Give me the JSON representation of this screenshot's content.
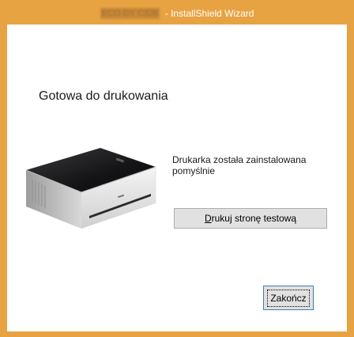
{
  "window": {
    "title_redacted": "ECO-DY CIDB",
    "title_suffix": "- InstallShield Wizard",
    "accent_color": "#e7a342"
  },
  "content": {
    "heading": "Gotowa do drukowania",
    "status_message": "Drukarka została zainstalowana pomyślnie",
    "printer_image": "printer-illustration"
  },
  "buttons": {
    "test_print_mnemonic": "D",
    "test_print_rest": "rukuj stronę testową",
    "finish_label": "Zakończ"
  }
}
